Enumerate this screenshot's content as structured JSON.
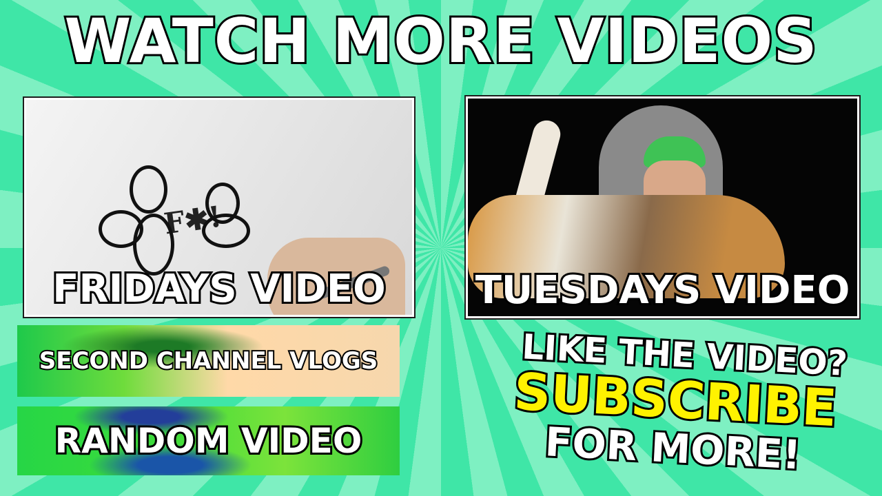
{
  "page": {
    "title": "WATCH MORE VIDEOS"
  },
  "thumbnails": [
    {
      "label": "FRIDAYS VIDEO"
    },
    {
      "label": "TUESDAYS VIDEO"
    }
  ],
  "links": [
    {
      "label": "SECOND CHANNEL VLOGS"
    },
    {
      "label": "RANDOM VIDEO"
    }
  ],
  "cta": {
    "line1": "LIKE THE VIDEO?",
    "line2": "SUBSCRIBE",
    "line3": "FOR MORE!"
  },
  "friday_scribble": "F✱!",
  "colors": {
    "background_light": "#7ef0c2",
    "background_dark": "#3fe6a7",
    "subscribe": "#fff200",
    "text": "#ffffff",
    "outline": "#000000"
  }
}
